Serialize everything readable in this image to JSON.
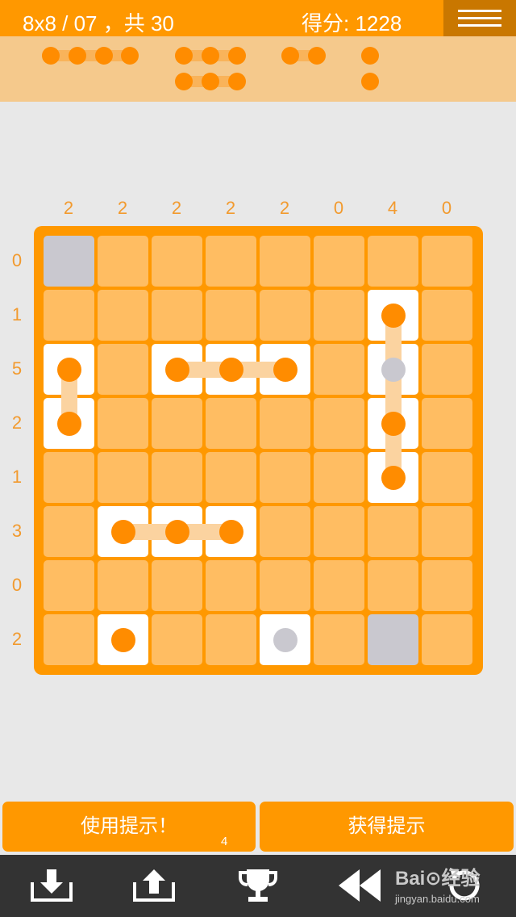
{
  "header": {
    "level_text": "8x8 / 07 ，共 30",
    "score_text": "得分: 1228",
    "menu_icon": "hamburger-menu-icon"
  },
  "fleet": {
    "ships": [
      {
        "length": 4,
        "status": "unplaced"
      },
      {
        "length": 3,
        "status": "unplaced"
      },
      {
        "length": 3,
        "status": "unplaced"
      },
      {
        "length": 2,
        "status": "unplaced"
      },
      {
        "length": 1,
        "status": "unplaced"
      },
      {
        "length": 1,
        "status": "unplaced"
      }
    ]
  },
  "puzzle": {
    "size": 8,
    "column_clues": [
      "2",
      "2",
      "2",
      "2",
      "2",
      "0",
      "4",
      "0"
    ],
    "row_clues": [
      "0",
      "1",
      "5",
      "2",
      "1",
      "3",
      "0",
      "2"
    ],
    "grid": [
      [
        "X",
        ".",
        ".",
        ".",
        ".",
        ".",
        ".",
        "."
      ],
      [
        ".",
        ".",
        ".",
        ".",
        ".",
        ".",
        "N",
        "."
      ],
      [
        "N",
        ".",
        "W",
        "M",
        "E",
        ".",
        "m",
        "."
      ],
      [
        "S",
        ".",
        ".",
        ".",
        ".",
        ".",
        "M",
        "."
      ],
      [
        ".",
        ".",
        ".",
        ".",
        ".",
        ".",
        "S",
        "."
      ],
      [
        ".",
        "W",
        "M",
        "E",
        ".",
        ".",
        ".",
        "."
      ],
      [
        ".",
        ".",
        ".",
        ".",
        ".",
        ".",
        ".",
        "."
      ],
      [
        ".",
        "O",
        ".",
        ".",
        "o",
        ".",
        "X",
        "."
      ]
    ],
    "legend": {
      ".": "empty",
      "X": "water",
      "O": "single ship",
      "o": "single ship hint",
      "N": "ship end top",
      "S": "ship end bottom",
      "W": "ship end left",
      "E": "ship end right",
      "M": "ship middle",
      "m": "ship middle hint"
    }
  },
  "buttons": {
    "use_hint_label": "使用提示！",
    "hint_count": "4",
    "get_hint_label": "获得提示"
  },
  "toolbar": {
    "icons": [
      "download-icon",
      "upload-icon",
      "trophy-icon",
      "rewind-icon",
      "undo-icon"
    ]
  },
  "watermark": {
    "line1": "Bai⊙经验",
    "line2": "jingyan.baidu.com"
  },
  "colors": {
    "accent": "#ff9800",
    "cell": "#ffbd62",
    "ship_dot": "#ff8c00",
    "hint_gray": "#c9c8cf",
    "fleet_bg": "#f5c98c",
    "clue_text": "#f29a2e",
    "toolbar_bg": "#333333"
  }
}
